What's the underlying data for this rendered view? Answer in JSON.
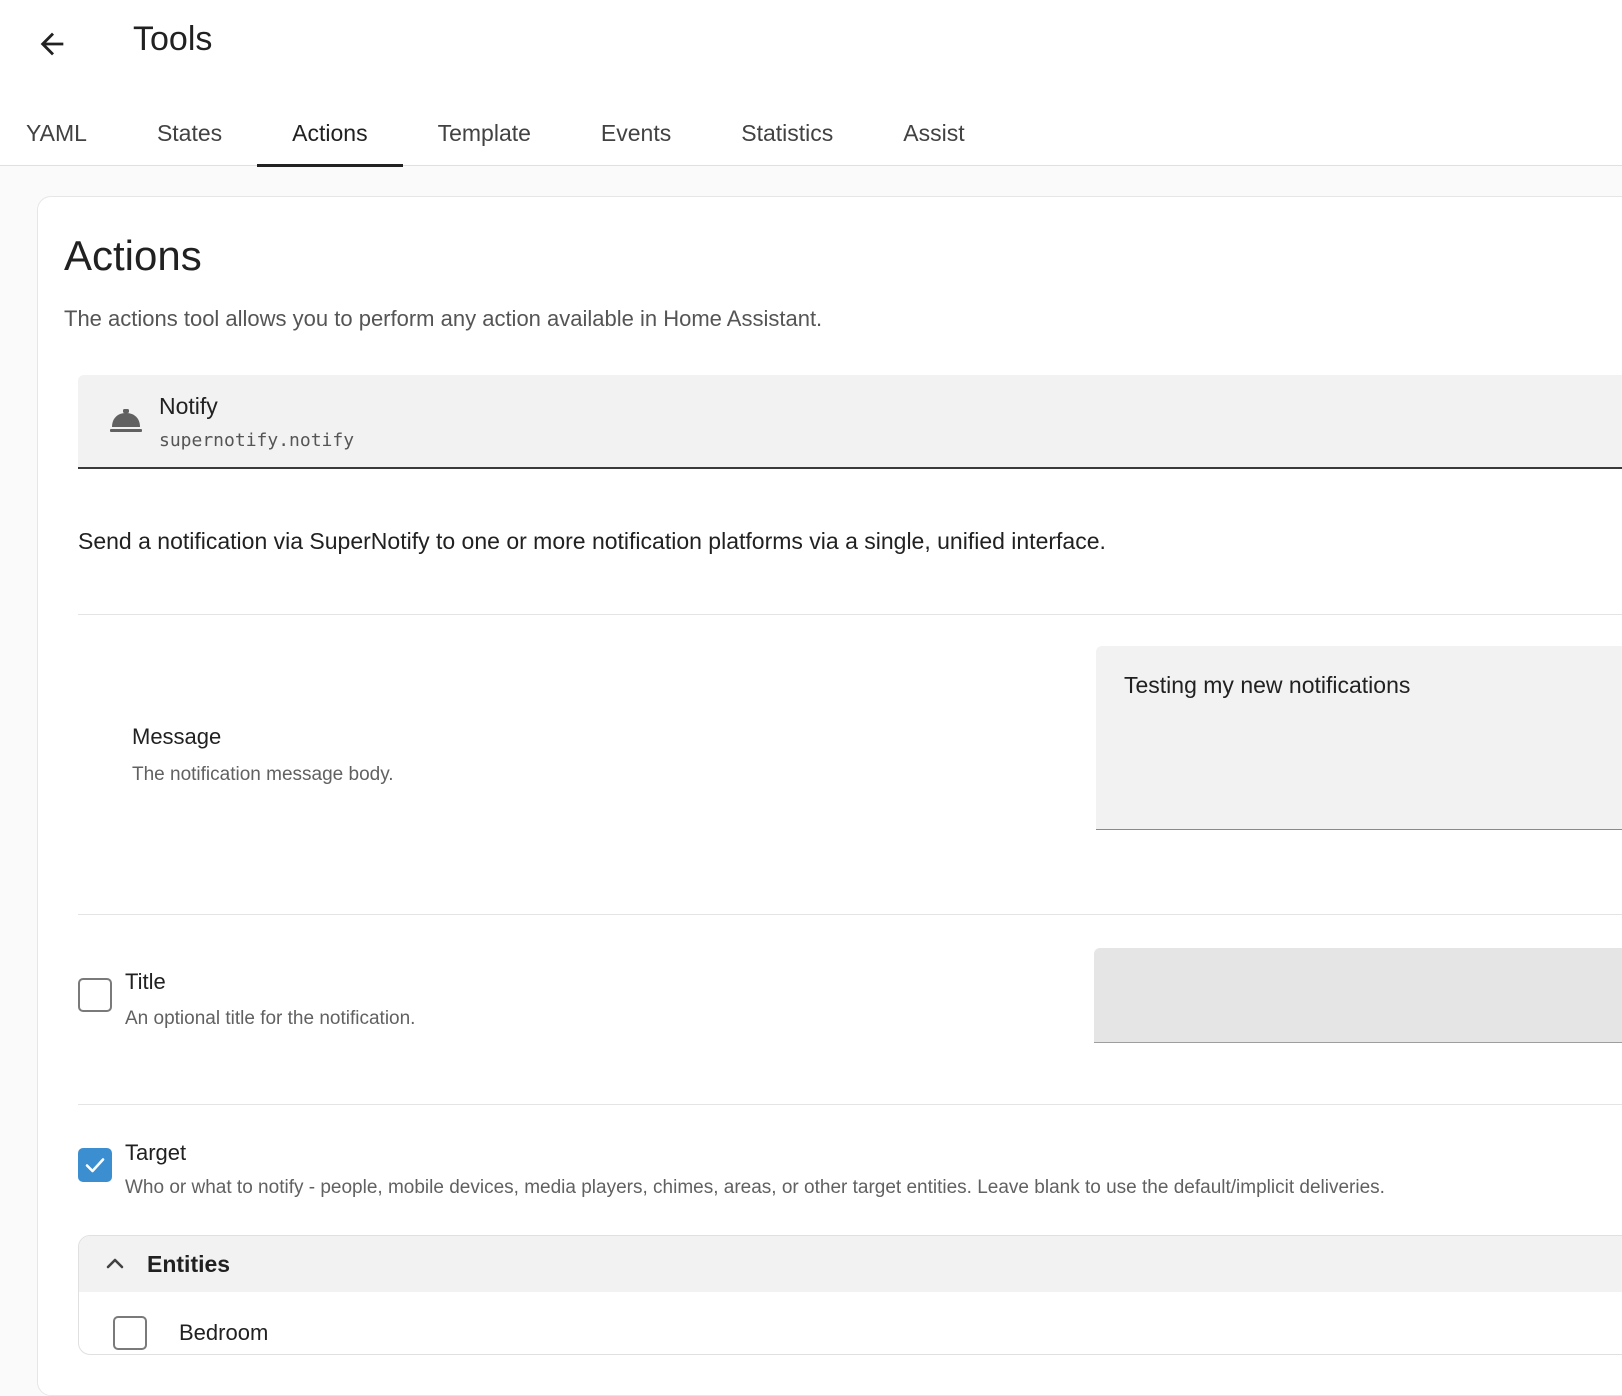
{
  "header": {
    "title": "Tools",
    "back_icon": "arrow-left-icon"
  },
  "tabs": [
    {
      "label": "YAML"
    },
    {
      "label": "States"
    },
    {
      "label": "Actions",
      "active": true
    },
    {
      "label": "Template"
    },
    {
      "label": "Events"
    },
    {
      "label": "Statistics"
    },
    {
      "label": "Assist"
    }
  ],
  "card": {
    "title": "Actions",
    "description": "The actions tool allows you to perform any action available in Home Assistant."
  },
  "action_picker": {
    "name": "Notify",
    "service_id": "supernotify.notify",
    "icon": "bell-icon"
  },
  "service_description": "Send a notification via SuperNotify to one or more notification platforms via a single, unified interface.",
  "fields": {
    "message": {
      "label": "Message",
      "help": "The notification message body.",
      "value": "Testing my new notifications"
    },
    "title": {
      "label": "Title",
      "help": "An optional title for the notification.",
      "checked": false,
      "value": ""
    },
    "target": {
      "label": "Target",
      "help": "Who or what to notify - people, mobile devices, media players, chimes, areas, or other target entities. Leave blank to use the default/implicit deliveries.",
      "checked": true
    }
  },
  "entities": {
    "title": "Entities",
    "items": [
      {
        "label": "Bedroom"
      }
    ]
  },
  "colors": {
    "accent": "#3b8fd0",
    "tab_indicator": "#212121"
  }
}
